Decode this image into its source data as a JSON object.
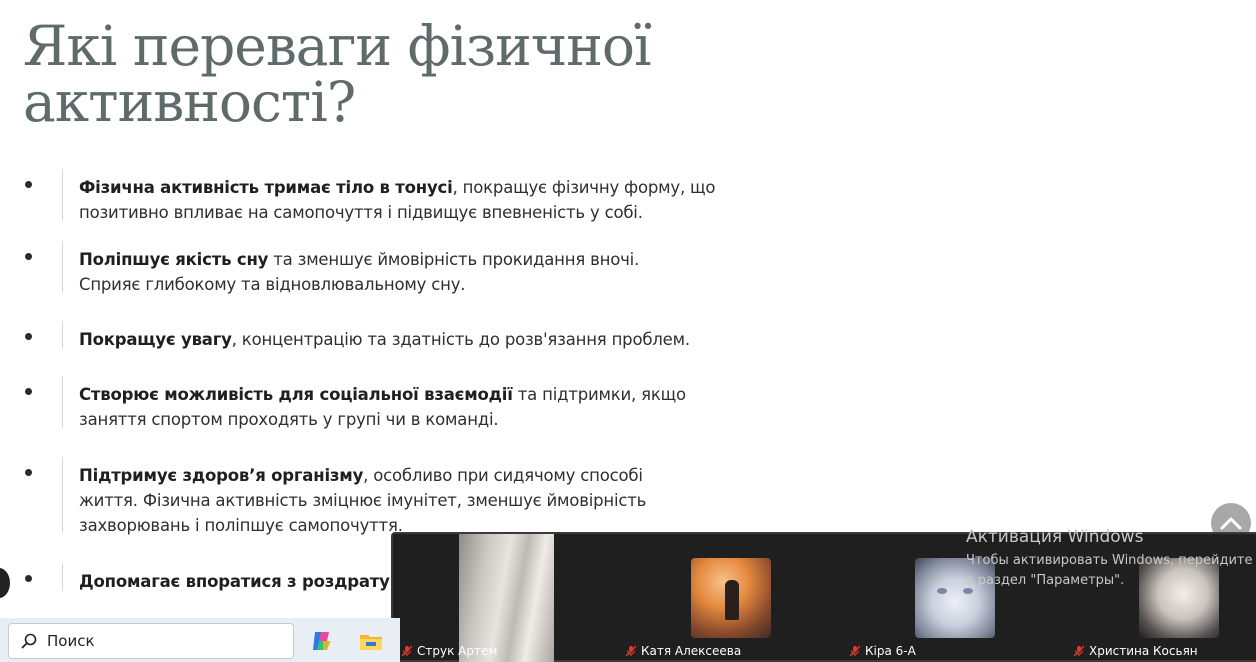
{
  "slide": {
    "title_line1": "Які переваги фізичної",
    "title_line2": "активності?",
    "bullets": [
      {
        "bold": "Фізична активність тримає тіло в тонусі",
        "rest_line1": ", покращує фізичну форму, що",
        "line2": "позитивно впливає на самопочуття і підвищує впевненість у собі.",
        "line3": ""
      },
      {
        "bold": "Поліпшує якість сну",
        "rest_line1": " та зменшує ймовірність прокидання вночі.",
        "line2": "Сприяє глибокому та відновлювальному сну.",
        "line3": ""
      },
      {
        "bold": "Покращує увагу",
        "rest_line1": ", концентрацію та здатність до розв'язання проблем.",
        "line2": "",
        "line3": ""
      },
      {
        "bold": "Створює можливість для соціальної взаємодії",
        "rest_line1": " та підтримки, якщо",
        "line2": "заняття спортом проходять у групі чи в команді.",
        "line3": ""
      },
      {
        "bold": "Підтримує здоров’я організму",
        "rest_line1": ", особливо при сидячому способі",
        "line2": "життя. Фізична активність зміцнює імунітет, зменшує ймовірність",
        "line3": "захворювань і поліпшує самопочуття."
      },
      {
        "bold": "Допомагає впоратися з роздратува",
        "rest_line1": "",
        "line2": "",
        "line3": ""
      }
    ]
  },
  "video_panel": {
    "participants": [
      {
        "name": "Струк Артем",
        "muted": true
      },
      {
        "name": "Катя Алексеева",
        "muted": true
      },
      {
        "name": "Кіра 6-А",
        "muted": true
      },
      {
        "name": "Христина Косьян",
        "muted": true
      }
    ]
  },
  "watermark": {
    "title": "Активация Windows",
    "line1": "Чтобы активировать Windows, перейдите",
    "line2": "в раздел \"Параметры\"."
  },
  "taskbar": {
    "search_placeholder": "Поиск"
  },
  "icons": {
    "scroll_top": "chevron-up-icon",
    "search": "search-icon",
    "copilot": "copilot-icon",
    "explorer": "file-explorer-icon",
    "mic_off": "mic-off-icon"
  },
  "colors": {
    "title": "#5f6b6b",
    "panel_bg": "#1f1f1f",
    "mic_off": "#e0372f"
  }
}
